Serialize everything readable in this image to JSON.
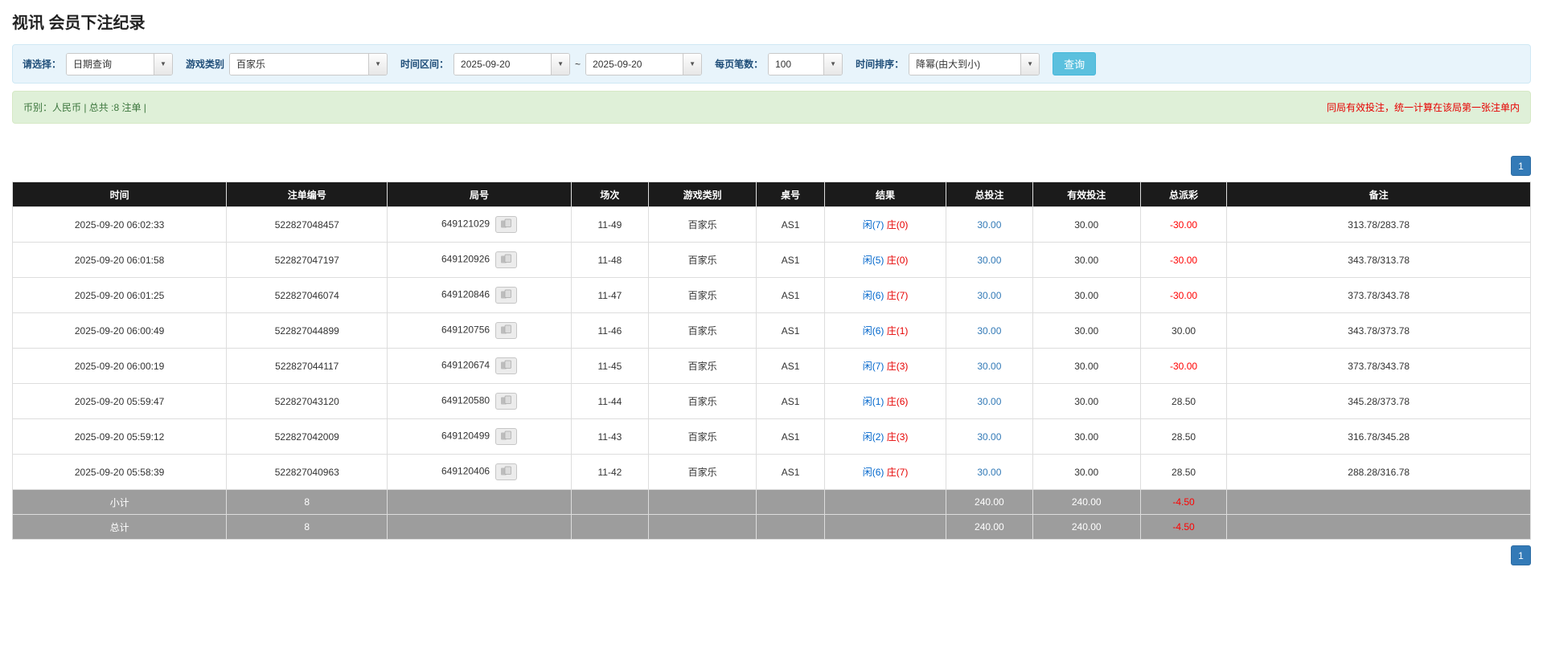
{
  "page": {
    "title": "视讯 会员下注纪录"
  },
  "filters": {
    "select_label": "请选择：",
    "select_value": "日期查询",
    "game_type_label": "游戏类别",
    "game_type_value": "百家乐",
    "time_range_label": "时间区间：",
    "date_from": "2025-09-20",
    "tilde": "~",
    "date_to": "2025-09-20",
    "page_size_label": "每页笔数：",
    "page_size_value": "100",
    "sort_label": "时间排序：",
    "sort_value": "降幂(由大到小)",
    "search_button": "查询"
  },
  "summary": {
    "left": "币别：人民币 | 总共 :8 注单 |",
    "right": "同局有效投注，统一计算在该局第一张注单内"
  },
  "pagination": {
    "page": "1"
  },
  "table": {
    "headers": [
      "时间",
      "注单编号",
      "局号",
      "场次",
      "游戏类别",
      "桌号",
      "结果",
      "总投注",
      "有效投注",
      "总派彩",
      "备注"
    ],
    "rows": [
      {
        "time": "2025-09-20 06:02:33",
        "bet_id": "522827048457",
        "round_id": "649121029",
        "session": "11-49",
        "game": "百家乐",
        "table_no": "AS1",
        "result_player": "闲(7)",
        "result_banker": "庄(0)",
        "total_bet": "30.00",
        "valid_bet": "30.00",
        "payout": "-30.00",
        "note": "313.78/283.78"
      },
      {
        "time": "2025-09-20 06:01:58",
        "bet_id": "522827047197",
        "round_id": "649120926",
        "session": "11-48",
        "game": "百家乐",
        "table_no": "AS1",
        "result_player": "闲(5)",
        "result_banker": "庄(0)",
        "total_bet": "30.00",
        "valid_bet": "30.00",
        "payout": "-30.00",
        "note": "343.78/313.78"
      },
      {
        "time": "2025-09-20 06:01:25",
        "bet_id": "522827046074",
        "round_id": "649120846",
        "session": "11-47",
        "game": "百家乐",
        "table_no": "AS1",
        "result_player": "闲(6)",
        "result_banker": "庄(7)",
        "total_bet": "30.00",
        "valid_bet": "30.00",
        "payout": "-30.00",
        "note": "373.78/343.78"
      },
      {
        "time": "2025-09-20 06:00:49",
        "bet_id": "522827044899",
        "round_id": "649120756",
        "session": "11-46",
        "game": "百家乐",
        "table_no": "AS1",
        "result_player": "闲(6)",
        "result_banker": "庄(1)",
        "total_bet": "30.00",
        "valid_bet": "30.00",
        "payout": "30.00",
        "note": "343.78/373.78"
      },
      {
        "time": "2025-09-20 06:00:19",
        "bet_id": "522827044117",
        "round_id": "649120674",
        "session": "11-45",
        "game": "百家乐",
        "table_no": "AS1",
        "result_player": "闲(7)",
        "result_banker": "庄(3)",
        "total_bet": "30.00",
        "valid_bet": "30.00",
        "payout": "-30.00",
        "note": "373.78/343.78"
      },
      {
        "time": "2025-09-20 05:59:47",
        "bet_id": "522827043120",
        "round_id": "649120580",
        "session": "11-44",
        "game": "百家乐",
        "table_no": "AS1",
        "result_player": "闲(1)",
        "result_banker": "庄(6)",
        "total_bet": "30.00",
        "valid_bet": "30.00",
        "payout": "28.50",
        "note": "345.28/373.78"
      },
      {
        "time": "2025-09-20 05:59:12",
        "bet_id": "522827042009",
        "round_id": "649120499",
        "session": "11-43",
        "game": "百家乐",
        "table_no": "AS1",
        "result_player": "闲(2)",
        "result_banker": "庄(3)",
        "total_bet": "30.00",
        "valid_bet": "30.00",
        "payout": "28.50",
        "note": "316.78/345.28"
      },
      {
        "time": "2025-09-20 05:58:39",
        "bet_id": "522827040963",
        "round_id": "649120406",
        "session": "11-42",
        "game": "百家乐",
        "table_no": "AS1",
        "result_player": "闲(6)",
        "result_banker": "庄(7)",
        "total_bet": "30.00",
        "valid_bet": "30.00",
        "payout": "28.50",
        "note": "288.28/316.78"
      }
    ],
    "subtotal": {
      "label": "小计",
      "count": "8",
      "total_bet": "240.00",
      "valid_bet": "240.00",
      "payout": "-4.50"
    },
    "total": {
      "label": "总计",
      "count": "8",
      "total_bet": "240.00",
      "valid_bet": "240.00",
      "payout": "-4.50"
    }
  }
}
